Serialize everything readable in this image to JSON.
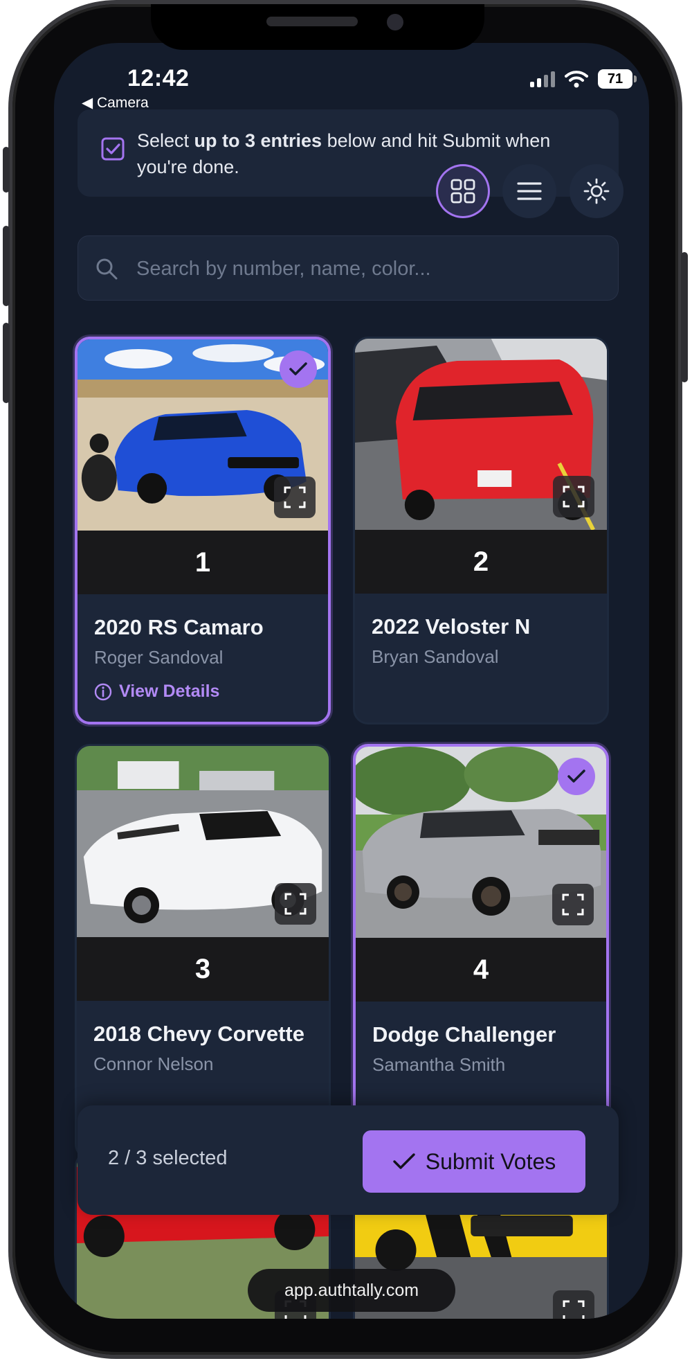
{
  "status_bar": {
    "time": "12:42",
    "back_label": "◀ Camera",
    "battery": "71",
    "icons": [
      "cellular-signal-icon",
      "wifi-icon",
      "battery-icon"
    ]
  },
  "instructions": {
    "text_before": "Select ",
    "text_bold": "up to 3 entries",
    "text_after": " below and hit Submit when you're done.",
    "icon": "checkbox-icon"
  },
  "view_controls": {
    "icons": [
      "grid-view-icon",
      "list-view-icon",
      "theme-toggle-icon"
    ],
    "active": "grid-view-icon"
  },
  "search": {
    "placeholder": "Search by number, name, color...",
    "value": ""
  },
  "entries": [
    {
      "number": "1",
      "title": "2020 RS Camaro",
      "owner": "Roger Sandoval",
      "selected": true,
      "link": "View Details",
      "car_color": "#1f4fd6"
    },
    {
      "number": "2",
      "title": "2022 Veloster N",
      "owner": "Bryan Sandoval",
      "selected": false,
      "car_color": "#e0242b"
    },
    {
      "number": "3",
      "title": "2018 Chevy Corvette",
      "owner": "Connor Nelson",
      "selected": false,
      "car_color": "#f3f4f6"
    },
    {
      "number": "4",
      "title": "Dodge Challenger",
      "owner": "Samantha Smith",
      "selected": true,
      "car_color": "#a9abb0"
    },
    {
      "number": "",
      "title": "",
      "owner": "",
      "selected": false,
      "car_color": "#d7161d"
    },
    {
      "number": "",
      "title": "",
      "owner": "",
      "selected": false,
      "car_color": "#f1cc12"
    }
  ],
  "submit": {
    "count_label": "2 / 3 selected",
    "button_label": "Submit Votes"
  },
  "browser": {
    "url": "app.authtally.com"
  },
  "colors": {
    "accent": "#a374f0",
    "background": "#141c2c",
    "card": "#1c2639"
  }
}
